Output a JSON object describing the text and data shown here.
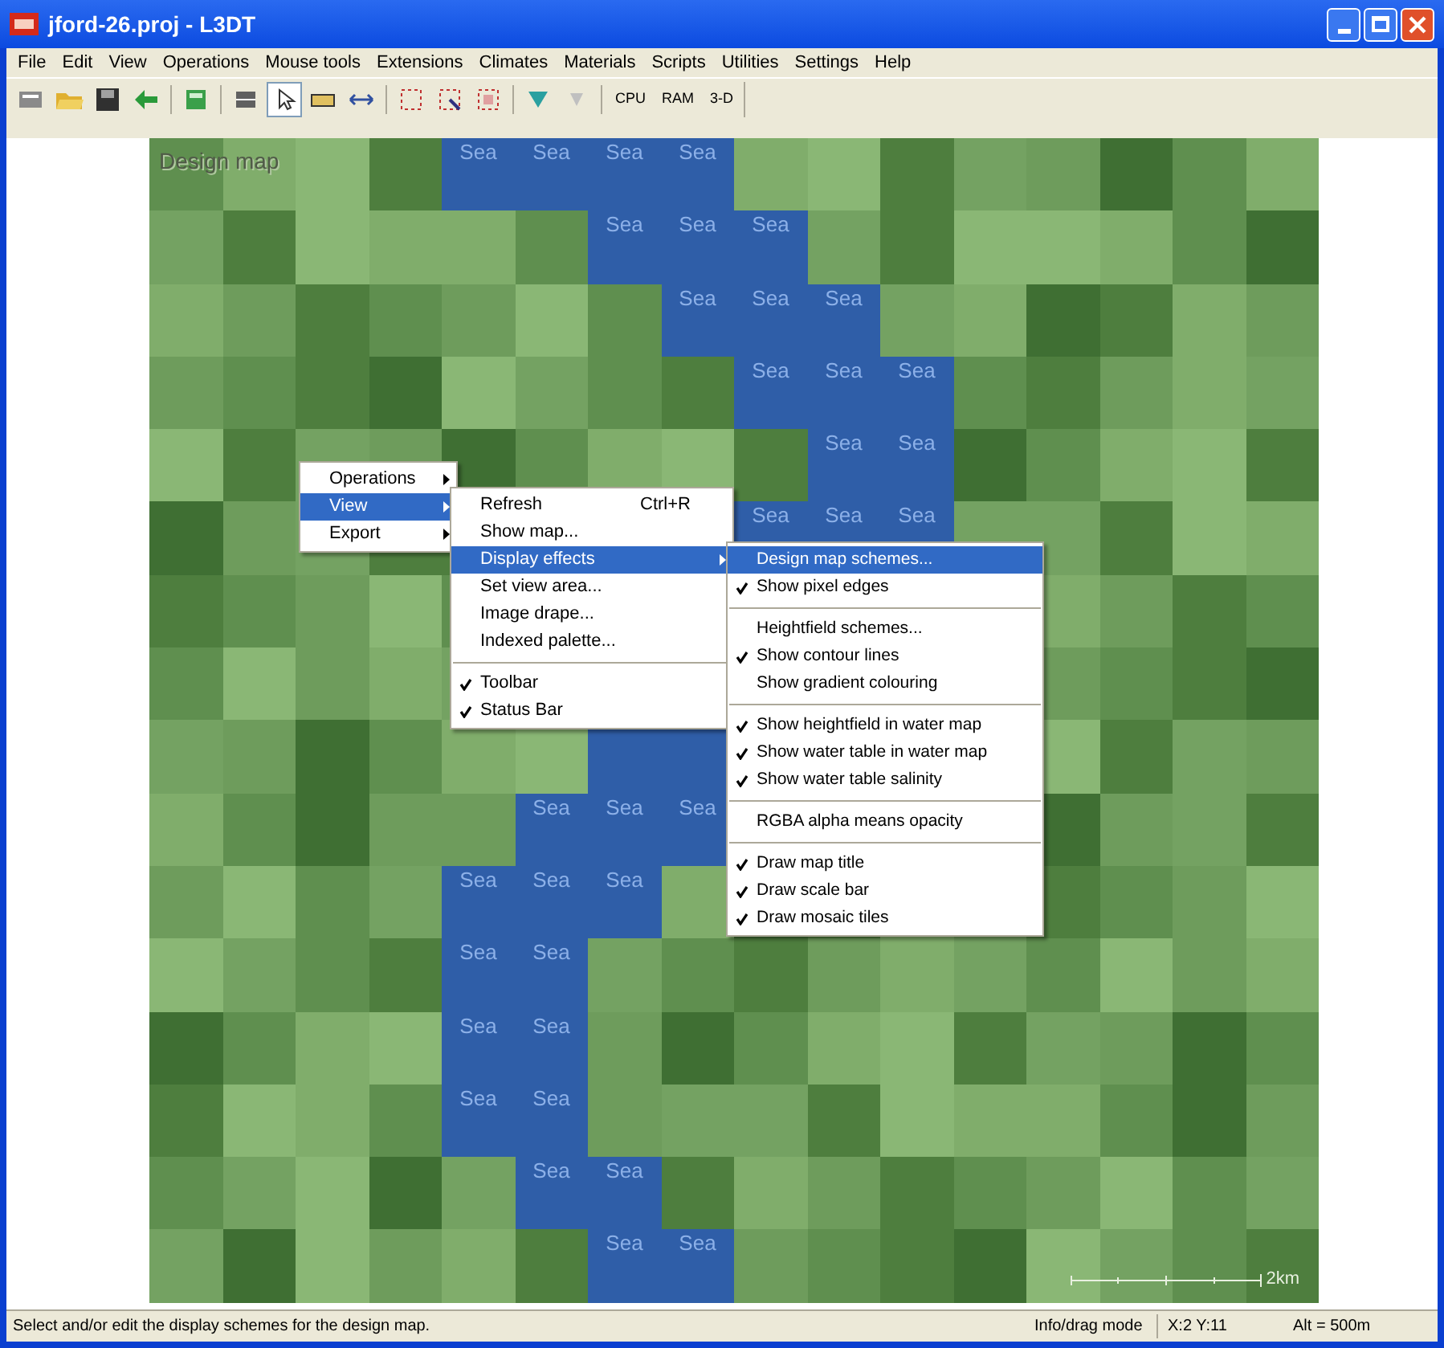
{
  "window": {
    "title": "jford-26.proj - L3DT"
  },
  "menu_bar": [
    "File",
    "Edit",
    "View",
    "Operations",
    "Mouse tools",
    "Extensions",
    "Climates",
    "Materials",
    "Scripts",
    "Utilities",
    "Settings",
    "Help"
  ],
  "toolbar": {
    "tools": [
      {
        "selected": false
      },
      {
        "selected": false
      },
      {
        "selected": false
      },
      {
        "selected": false
      },
      {
        "selected": false
      },
      {
        "selected": false
      },
      {
        "selected": true
      },
      {
        "selected": false
      },
      {
        "selected": false
      },
      {
        "selected": false
      },
      {
        "selected": false
      },
      {
        "selected": false
      },
      {
        "selected": false
      },
      {
        "selected": false
      }
    ],
    "text_buttons": [
      "CPU",
      "RAM",
      "3-D"
    ]
  },
  "map": {
    "title": "Design map",
    "rows": [
      {
        "labels": [
          "Sea",
          "Sea",
          "Sea",
          "Sea"
        ]
      },
      {
        "labels": [
          "Sea",
          "Sea",
          "Sea"
        ]
      },
      {
        "labels": [
          "Sea",
          "Sea",
          "Sea"
        ]
      },
      {
        "labels": [
          "Sea",
          "Sea",
          "Sea"
        ]
      },
      {
        "labels": [
          "Sea",
          "Sea"
        ]
      },
      {
        "labels": [
          "Sea",
          "Sea",
          "Sea"
        ]
      },
      {},
      {},
      {},
      {
        "labels": [
          "Sea",
          "Sea",
          "Sea"
        ]
      },
      {
        "labels": [
          "Sea",
          "Sea",
          "Sea"
        ]
      },
      {
        "labels": [
          "Sea",
          "Sea"
        ]
      },
      {
        "labels": [
          "Sea",
          "Sea"
        ]
      },
      {
        "labels": [
          "Sea",
          "Sea"
        ]
      },
      {
        "labels": [
          "Sea",
          "Sea"
        ]
      },
      {
        "labels": [
          "Sea",
          "Sea"
        ]
      }
    ],
    "scale_label": "2km"
  },
  "context_menu": [
    {
      "kind": "item",
      "label": "Operations",
      "selected": false,
      "submenu": true
    },
    {
      "kind": "item",
      "label": "View",
      "selected": true,
      "submenu": true
    },
    {
      "kind": "item",
      "label": "Export",
      "selected": false,
      "submenu": true
    }
  ],
  "view_menu": [
    {
      "kind": "item",
      "label": "Refresh",
      "shortcut": "Ctrl+R",
      "selected": false,
      "submenu": false,
      "checked": false
    },
    {
      "kind": "item",
      "label": "Show map...",
      "selected": false,
      "submenu": false,
      "checked": false
    },
    {
      "kind": "item",
      "label": "Display effects",
      "selected": true,
      "submenu": true,
      "checked": false
    },
    {
      "kind": "item",
      "label": "Set view area...",
      "selected": false,
      "submenu": false,
      "checked": false
    },
    {
      "kind": "item",
      "label": "Image drape...",
      "selected": false,
      "submenu": false,
      "checked": false
    },
    {
      "kind": "item",
      "label": "Indexed palette...",
      "selected": false,
      "submenu": false,
      "checked": false
    },
    {
      "kind": "separator"
    },
    {
      "kind": "item",
      "label": "Toolbar",
      "selected": false,
      "submenu": false,
      "checked": true
    },
    {
      "kind": "item",
      "label": "Status Bar",
      "selected": false,
      "submenu": false,
      "checked": true
    }
  ],
  "display_effects_menu": [
    {
      "kind": "item",
      "label": "Design map schemes...",
      "selected": true,
      "submenu": false,
      "checked": false
    },
    {
      "kind": "item",
      "label": "Show pixel edges",
      "selected": false,
      "submenu": false,
      "checked": true
    },
    {
      "kind": "separator"
    },
    {
      "kind": "item",
      "label": "Heightfield schemes...",
      "selected": false,
      "submenu": false,
      "checked": false
    },
    {
      "kind": "item",
      "label": "Show contour lines",
      "selected": false,
      "submenu": false,
      "checked": true
    },
    {
      "kind": "item",
      "label": "Show gradient colouring",
      "selected": false,
      "submenu": false,
      "checked": false
    },
    {
      "kind": "separator"
    },
    {
      "kind": "item",
      "label": "Show heightfield in water map",
      "selected": false,
      "submenu": false,
      "checked": true
    },
    {
      "kind": "item",
      "label": "Show water table in water map",
      "selected": false,
      "submenu": false,
      "checked": true
    },
    {
      "kind": "item",
      "label": "Show water table salinity",
      "selected": false,
      "submenu": false,
      "checked": true
    },
    {
      "kind": "separator"
    },
    {
      "kind": "item",
      "label": "RGBA alpha means opacity",
      "selected": false,
      "submenu": false,
      "checked": false
    },
    {
      "kind": "separator"
    },
    {
      "kind": "item",
      "label": "Draw map title",
      "selected": false,
      "submenu": false,
      "checked": true
    },
    {
      "kind": "item",
      "label": "Draw scale bar",
      "selected": false,
      "submenu": false,
      "checked": true
    },
    {
      "kind": "item",
      "label": "Draw mosaic tiles",
      "selected": false,
      "submenu": false,
      "checked": true
    }
  ],
  "status_bar": {
    "message": "Select and/or edit the display schemes for the design map.",
    "mode": "Info/drag mode",
    "position": "X:2 Y:11",
    "altitude": "Alt = 500m"
  }
}
